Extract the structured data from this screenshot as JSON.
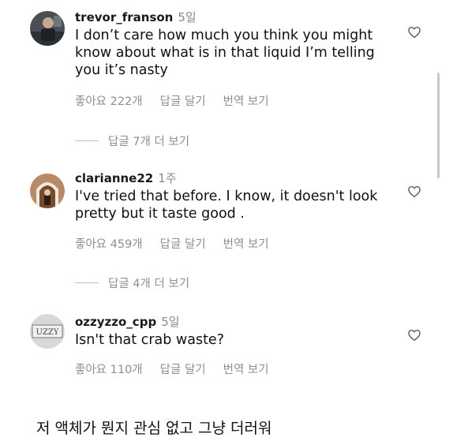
{
  "comments": [
    {
      "username": "trevor_franson",
      "time": "5일",
      "text": "I don’t care how much you think you might know about what is in that liquid I’m telling you it’s nasty",
      "likes": "좋아요 222개",
      "reply": "답글 달기",
      "translate": "번역 보기",
      "view_replies": "답글 7개 더 보기"
    },
    {
      "username": "clarianne22",
      "time": "1주",
      "text": "I've tried that before. I know, it doesn't look pretty but it taste good .",
      "likes": "좋아요 459개",
      "reply": "답글 달기",
      "translate": "번역 보기",
      "view_replies": "답글 4개 더 보기"
    },
    {
      "username": "ozzyzzo_cpp",
      "time": "5일",
      "text": "Isn't that crab waste?",
      "likes": "좋아요 110개",
      "reply": "답글 달기",
      "translate": "번역 보기",
      "avatar_text": "UZZY"
    }
  ],
  "caption": "저 액체가 뭔지 관심 없고 그냥 더러워",
  "icons": {
    "like": "heart-outline-icon"
  },
  "colors": {
    "secondary_text": "#8e8e8e",
    "primary_text": "#111111"
  }
}
